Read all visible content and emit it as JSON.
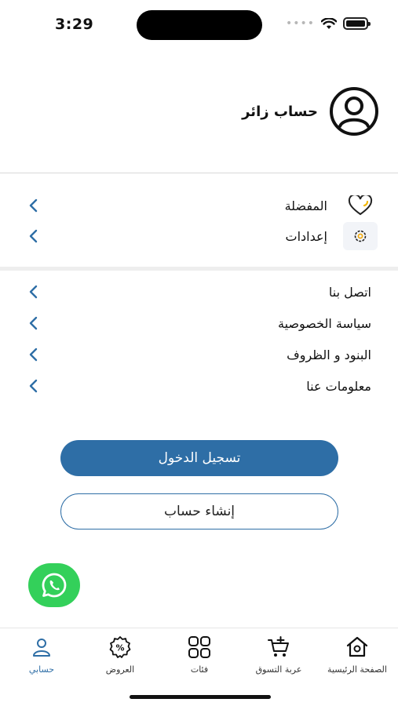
{
  "status": {
    "time": "3:29"
  },
  "profile": {
    "name": "حساب زائر"
  },
  "section1": [
    {
      "label": "المفضلة",
      "icon": "heart-icon"
    },
    {
      "label": "إعدادات",
      "icon": "gear-icon"
    }
  ],
  "section2": [
    {
      "label": "اتصل بنا"
    },
    {
      "label": "سياسة الخصوصية"
    },
    {
      "label": "البنود و الظروف"
    },
    {
      "label": "معلومات عنا"
    }
  ],
  "buttons": {
    "login": "تسجيل الدخول",
    "signup": "إنشاء حساب"
  },
  "tabs": [
    {
      "label": "حسابي",
      "icon": "account-icon",
      "active": true
    },
    {
      "label": "العروض",
      "icon": "offers-icon",
      "active": false
    },
    {
      "label": "فئات",
      "icon": "categories-icon",
      "active": false
    },
    {
      "label": "عربة التسوق",
      "icon": "cart-icon",
      "active": false
    },
    {
      "label": "الصفحة الرئيسية",
      "icon": "home-icon",
      "active": false
    }
  ],
  "colors": {
    "primary": "#2e6ea6",
    "whatsapp": "#33d05a"
  }
}
